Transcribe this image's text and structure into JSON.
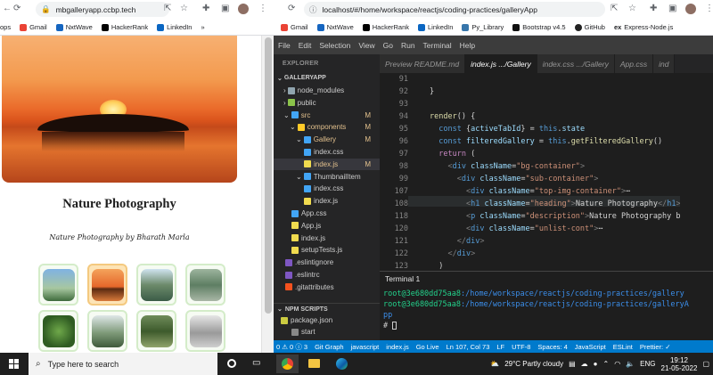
{
  "left_browser": {
    "url": "mbgalleryapp.ccbp.tech",
    "bookmarks": [
      "ops",
      "Gmail",
      "NxtWave",
      "HackerRank",
      "LinkedIn"
    ],
    "heading": "Nature Photography",
    "description": "Nature Photography by Bharath Marla"
  },
  "right_browser": {
    "url": "localhost/#/home/workspace/reactjs/coding-practices/galleryApp",
    "bookmarks": [
      "Gmail",
      "NxtWave",
      "HackerRank",
      "LinkedIn",
      "Py_Library",
      "Bootstrap v4.5",
      "GitHub",
      "Express-Node.js"
    ]
  },
  "vscode": {
    "menu": [
      "File",
      "Edit",
      "Selection",
      "View",
      "Go",
      "Run",
      "Terminal",
      "Help"
    ],
    "explorer_title": "EXPLORER",
    "tabs": [
      "Preview README.md",
      "index.js .../Gallery",
      "index.css .../Gallery",
      "App.css",
      "ind"
    ],
    "tree": [
      {
        "label": "GALLERYAPP",
        "indent": 0
      },
      {
        "label": "node_modules",
        "indent": 1
      },
      {
        "label": "public",
        "indent": 1
      },
      {
        "label": "src",
        "indent": 1,
        "m": "M"
      },
      {
        "label": "components",
        "indent": 2,
        "m": "M"
      },
      {
        "label": "Gallery",
        "indent": 3,
        "m": "M"
      },
      {
        "label": "index.css",
        "indent": 4
      },
      {
        "label": "index.js",
        "indent": 4,
        "m": "M"
      },
      {
        "label": "ThumbnailItem",
        "indent": 3
      },
      {
        "label": "index.css",
        "indent": 4
      },
      {
        "label": "index.js",
        "indent": 4
      },
      {
        "label": "App.css",
        "indent": 2
      },
      {
        "label": "App.js",
        "indent": 2
      },
      {
        "label": "index.js",
        "indent": 2
      },
      {
        "label": "setupTests.js",
        "indent": 2
      },
      {
        "label": ".eslintignore",
        "indent": 1
      },
      {
        "label": ".eslintrc",
        "indent": 1
      },
      {
        "label": ".gitattributes",
        "indent": 1
      }
    ],
    "npm_scripts_title": "NPM SCRIPTS",
    "npm_items": [
      "package.json",
      "start"
    ],
    "line_numbers": [
      "91",
      "92",
      "93",
      "94",
      "95",
      "96",
      "97",
      "98",
      "99",
      "107",
      "108",
      "118",
      "120",
      "121",
      "122",
      "123"
    ],
    "terminal_tab": "Terminal 1",
    "terminal_user": "root@3e680dd75aa8",
    "terminal_path1": ":/home/workspace/reactjs/coding-practices/gallery",
    "terminal_path2": ":/home/workspace/reactjs/coding-practices/galleryA",
    "terminal_wrap": "pp",
    "terminal_prompt": "# ",
    "status": [
      "0 ⚠ 0 ⓘ 3",
      "Git Graph",
      "javascript",
      "index.js",
      "Go Live",
      "Ln 107, Col 73",
      "LF",
      "UTF-8",
      "Spaces: 4",
      "JavaScript",
      "ESLint",
      "Prettier: ✓"
    ]
  },
  "taskbar": {
    "search_placeholder": "Type here to search",
    "weather": "29°C  Partly cloudy",
    "lang": "ENG",
    "time": "19:12",
    "date": "21-05-2022"
  },
  "colors": {
    "accent": "#007acc",
    "active_thumb": "#fde4b6"
  }
}
